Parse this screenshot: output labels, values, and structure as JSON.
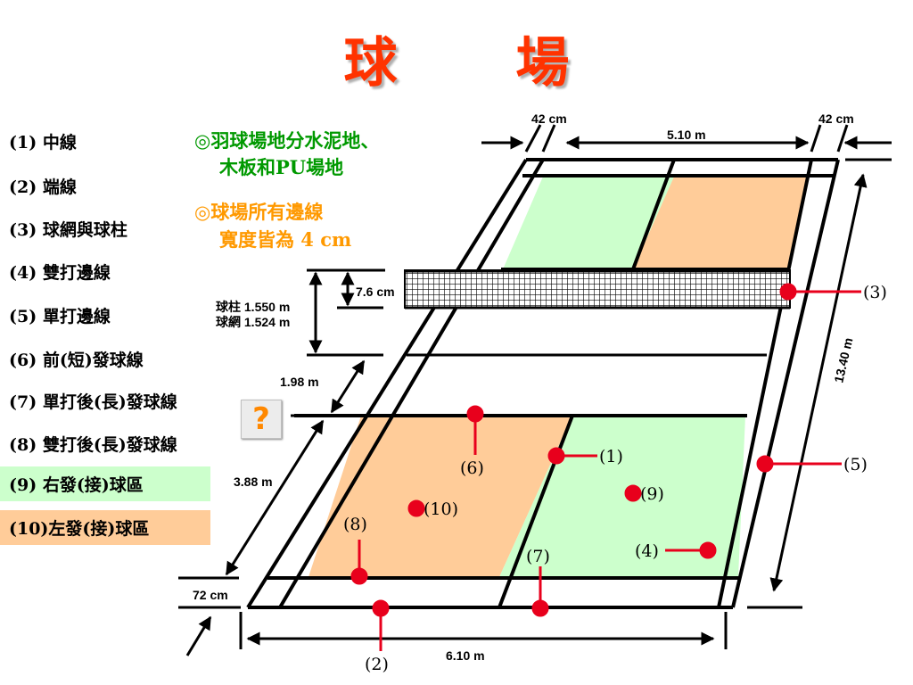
{
  "title": "球 場",
  "legend": [
    {
      "label": "(1) 中線"
    },
    {
      "label": "(2) 端線"
    },
    {
      "label": "(3) 球網與球柱"
    },
    {
      "label": "(4) 雙打邊線"
    },
    {
      "label": "(5) 單打邊線"
    },
    {
      "label": "(6) 前(短)發球線"
    },
    {
      "label": "(7) 單打後(長)發球線"
    },
    {
      "label": "(8) 雙打後(長)發球線"
    },
    {
      "label": "(9) 右發(接)球區",
      "highlight": "#ccffcc"
    },
    {
      "label": "(10)左發(接)球區",
      "highlight": "#ffcc99"
    }
  ],
  "notes": {
    "surface_line1": "◎羽球場地分水泥地、",
    "surface_line2": "木板和PU場地",
    "width_line1": "◎球場所有邊線",
    "width_line2": "寬度皆為 4 cm"
  },
  "dimensions": {
    "side_margin_left": "42 cm",
    "side_margin_right": "42 cm",
    "singles_width": "5.10 m",
    "net_tape": "7.6 cm",
    "post_height": "球柱 1.550 m",
    "net_height": "球網 1.524 m",
    "short_service": "1.98 m",
    "service_depth": "3.88 m",
    "back_margin": "72 cm",
    "doubles_width": "6.10 m",
    "length": "13.40 m"
  },
  "callouts": {
    "c1": "(1)",
    "c2": "(2)",
    "c3": "(3)",
    "c4": "(4)",
    "c5": "(5)",
    "c6": "(6)",
    "c7": "(7)",
    "c8": "(8)",
    "c9": "(9)",
    "c10": "(10)"
  },
  "help_button": "?",
  "colors": {
    "title": "#ff3300",
    "green_zone": "#ccffcc",
    "orange_zone": "#ffcc99",
    "callout_red": "#e8001c",
    "note_green": "#009900",
    "note_orange": "#ff9900"
  }
}
